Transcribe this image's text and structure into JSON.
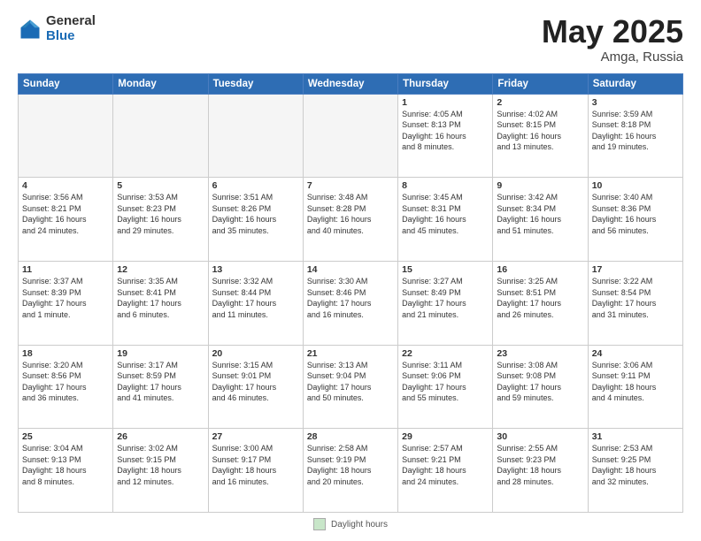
{
  "header": {
    "logo_general": "General",
    "logo_blue": "Blue",
    "title": "May 2025",
    "location": "Amga, Russia"
  },
  "weekdays": [
    "Sunday",
    "Monday",
    "Tuesday",
    "Wednesday",
    "Thursday",
    "Friday",
    "Saturday"
  ],
  "weeks": [
    [
      {
        "day": "",
        "info": ""
      },
      {
        "day": "",
        "info": ""
      },
      {
        "day": "",
        "info": ""
      },
      {
        "day": "",
        "info": ""
      },
      {
        "day": "1",
        "info": "Sunrise: 4:05 AM\nSunset: 8:13 PM\nDaylight: 16 hours\nand 8 minutes."
      },
      {
        "day": "2",
        "info": "Sunrise: 4:02 AM\nSunset: 8:15 PM\nDaylight: 16 hours\nand 13 minutes."
      },
      {
        "day": "3",
        "info": "Sunrise: 3:59 AM\nSunset: 8:18 PM\nDaylight: 16 hours\nand 19 minutes."
      }
    ],
    [
      {
        "day": "4",
        "info": "Sunrise: 3:56 AM\nSunset: 8:21 PM\nDaylight: 16 hours\nand 24 minutes."
      },
      {
        "day": "5",
        "info": "Sunrise: 3:53 AM\nSunset: 8:23 PM\nDaylight: 16 hours\nand 29 minutes."
      },
      {
        "day": "6",
        "info": "Sunrise: 3:51 AM\nSunset: 8:26 PM\nDaylight: 16 hours\nand 35 minutes."
      },
      {
        "day": "7",
        "info": "Sunrise: 3:48 AM\nSunset: 8:28 PM\nDaylight: 16 hours\nand 40 minutes."
      },
      {
        "day": "8",
        "info": "Sunrise: 3:45 AM\nSunset: 8:31 PM\nDaylight: 16 hours\nand 45 minutes."
      },
      {
        "day": "9",
        "info": "Sunrise: 3:42 AM\nSunset: 8:34 PM\nDaylight: 16 hours\nand 51 minutes."
      },
      {
        "day": "10",
        "info": "Sunrise: 3:40 AM\nSunset: 8:36 PM\nDaylight: 16 hours\nand 56 minutes."
      }
    ],
    [
      {
        "day": "11",
        "info": "Sunrise: 3:37 AM\nSunset: 8:39 PM\nDaylight: 17 hours\nand 1 minute."
      },
      {
        "day": "12",
        "info": "Sunrise: 3:35 AM\nSunset: 8:41 PM\nDaylight: 17 hours\nand 6 minutes."
      },
      {
        "day": "13",
        "info": "Sunrise: 3:32 AM\nSunset: 8:44 PM\nDaylight: 17 hours\nand 11 minutes."
      },
      {
        "day": "14",
        "info": "Sunrise: 3:30 AM\nSunset: 8:46 PM\nDaylight: 17 hours\nand 16 minutes."
      },
      {
        "day": "15",
        "info": "Sunrise: 3:27 AM\nSunset: 8:49 PM\nDaylight: 17 hours\nand 21 minutes."
      },
      {
        "day": "16",
        "info": "Sunrise: 3:25 AM\nSunset: 8:51 PM\nDaylight: 17 hours\nand 26 minutes."
      },
      {
        "day": "17",
        "info": "Sunrise: 3:22 AM\nSunset: 8:54 PM\nDaylight: 17 hours\nand 31 minutes."
      }
    ],
    [
      {
        "day": "18",
        "info": "Sunrise: 3:20 AM\nSunset: 8:56 PM\nDaylight: 17 hours\nand 36 minutes."
      },
      {
        "day": "19",
        "info": "Sunrise: 3:17 AM\nSunset: 8:59 PM\nDaylight: 17 hours\nand 41 minutes."
      },
      {
        "day": "20",
        "info": "Sunrise: 3:15 AM\nSunset: 9:01 PM\nDaylight: 17 hours\nand 46 minutes."
      },
      {
        "day": "21",
        "info": "Sunrise: 3:13 AM\nSunset: 9:04 PM\nDaylight: 17 hours\nand 50 minutes."
      },
      {
        "day": "22",
        "info": "Sunrise: 3:11 AM\nSunset: 9:06 PM\nDaylight: 17 hours\nand 55 minutes."
      },
      {
        "day": "23",
        "info": "Sunrise: 3:08 AM\nSunset: 9:08 PM\nDaylight: 17 hours\nand 59 minutes."
      },
      {
        "day": "24",
        "info": "Sunrise: 3:06 AM\nSunset: 9:11 PM\nDaylight: 18 hours\nand 4 minutes."
      }
    ],
    [
      {
        "day": "25",
        "info": "Sunrise: 3:04 AM\nSunset: 9:13 PM\nDaylight: 18 hours\nand 8 minutes."
      },
      {
        "day": "26",
        "info": "Sunrise: 3:02 AM\nSunset: 9:15 PM\nDaylight: 18 hours\nand 12 minutes."
      },
      {
        "day": "27",
        "info": "Sunrise: 3:00 AM\nSunset: 9:17 PM\nDaylight: 18 hours\nand 16 minutes."
      },
      {
        "day": "28",
        "info": "Sunrise: 2:58 AM\nSunset: 9:19 PM\nDaylight: 18 hours\nand 20 minutes."
      },
      {
        "day": "29",
        "info": "Sunrise: 2:57 AM\nSunset: 9:21 PM\nDaylight: 18 hours\nand 24 minutes."
      },
      {
        "day": "30",
        "info": "Sunrise: 2:55 AM\nSunset: 9:23 PM\nDaylight: 18 hours\nand 28 minutes."
      },
      {
        "day": "31",
        "info": "Sunrise: 2:53 AM\nSunset: 9:25 PM\nDaylight: 18 hours\nand 32 minutes."
      }
    ]
  ],
  "footer": {
    "box_label": "Daylight hours"
  }
}
